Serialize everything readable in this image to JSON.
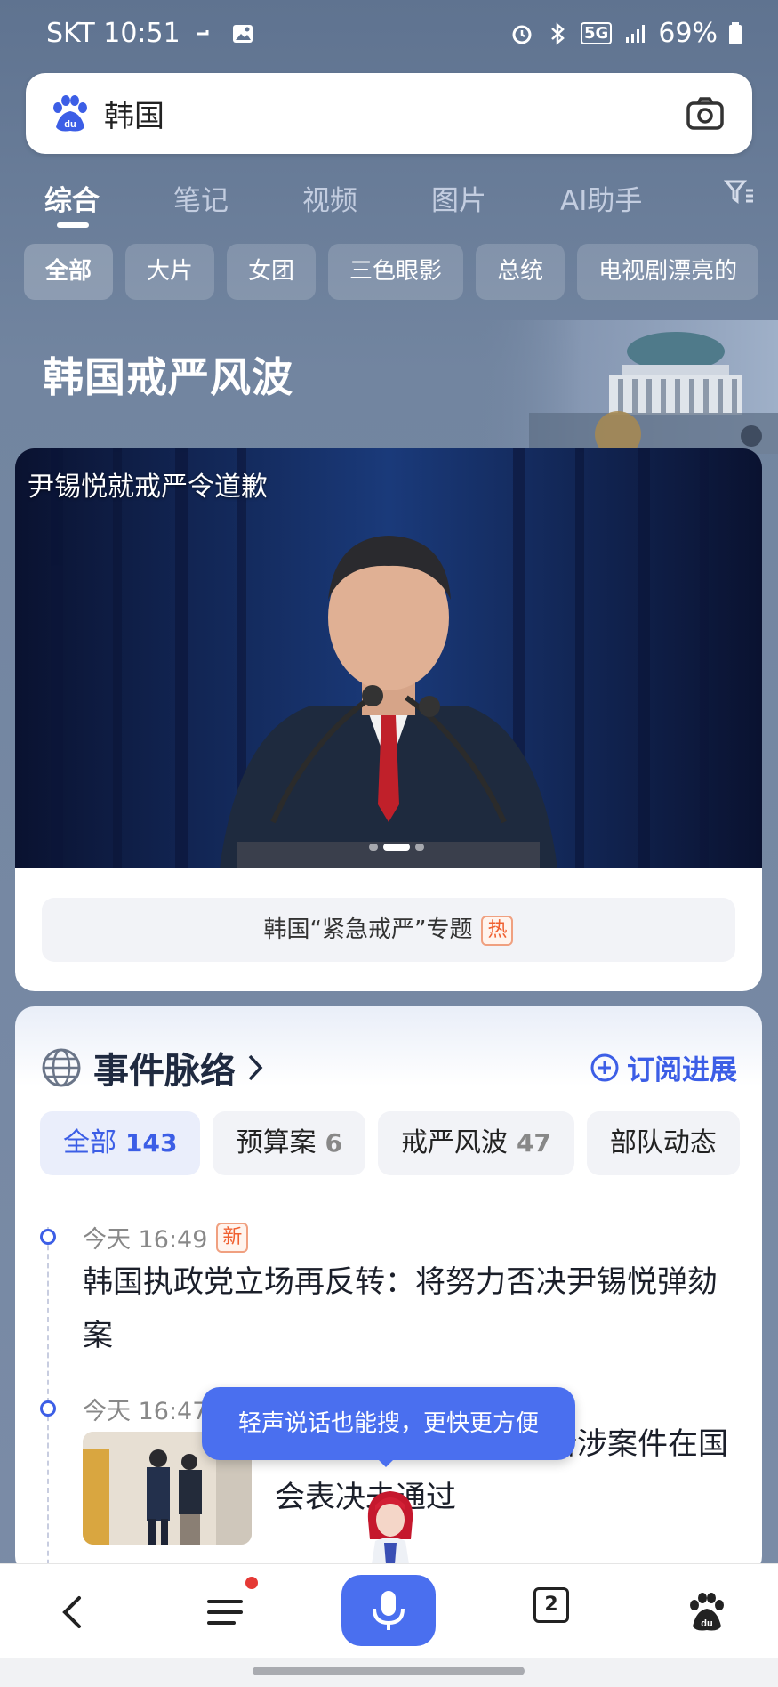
{
  "status_bar": {
    "carrier_time": "SKT 10:51",
    "battery": "69%",
    "network": "5G"
  },
  "search": {
    "query": "韩国"
  },
  "tabs": [
    {
      "label": "综合",
      "active": true
    },
    {
      "label": "笔记"
    },
    {
      "label": "视频"
    },
    {
      "label": "图片"
    },
    {
      "label": "AI助手"
    }
  ],
  "chips": [
    {
      "label": "全部",
      "active": true
    },
    {
      "label": "大片"
    },
    {
      "label": "女团"
    },
    {
      "label": "三色眼影"
    },
    {
      "label": "总统"
    },
    {
      "label": "电视剧漂亮的"
    }
  ],
  "topic": {
    "title": "韩国戒严风波"
  },
  "video": {
    "caption": "尹锡悦就戒严令道歉"
  },
  "special": {
    "label": "韩国“紧急戒严”专题",
    "badge": "热"
  },
  "timeline": {
    "title": "事件脉络",
    "subscribe_label": "订阅进展",
    "filters": [
      {
        "label": "全部",
        "count": "143",
        "active": true
      },
      {
        "label": "预算案",
        "count": "6"
      },
      {
        "label": "戒严风波",
        "count": "47"
      },
      {
        "label": "部队动态",
        "count": ""
      }
    ],
    "items": [
      {
        "time": "今天 16:49",
        "badge": "新",
        "text": "韩国执政党立场再反转：将努力否决尹锡悦弹劾案"
      },
      {
        "time": "今天 16:47",
        "text": "韩国总统尹锡悦夫人所涉案件在国会表决未通过"
      }
    ]
  },
  "toast": {
    "text": "轻声说话也能搜，更快更方便"
  },
  "bottom_nav": {
    "tab_count": "2"
  },
  "colors": {
    "accent": "#4a6fef",
    "link_blue": "#3c5ee6",
    "hot_orange": "#f06030",
    "background": "#6c7f98"
  }
}
